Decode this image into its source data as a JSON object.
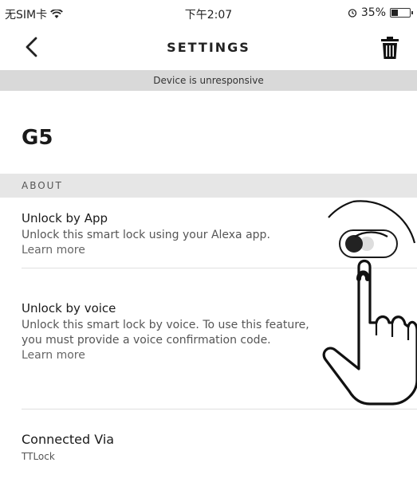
{
  "status_bar": {
    "carrier": "无SIM卡",
    "time": "下午2:07",
    "battery": "35%",
    "battery_level": 0.35
  },
  "nav": {
    "title": "SETTINGS"
  },
  "banner": {
    "text": "Device is unresponsive"
  },
  "device": {
    "name": "G5"
  },
  "section": {
    "header": "ABOUT"
  },
  "unlock_app": {
    "title": "Unlock by App",
    "description": "Unlock this smart lock using your Alexa app.",
    "link": "Learn more",
    "enabled": false
  },
  "unlock_voice": {
    "title": "Unlock by voice",
    "description": "Unlock this smart lock by voice. To use this feature, you must provide a voice confirmation code.",
    "link": "Learn more"
  },
  "connected": {
    "title": "Connected Via",
    "value": "TTLock"
  },
  "icons": {
    "back": "chevron-left-icon",
    "trash": "trash-icon",
    "wifi": "wifi-icon",
    "battery": "battery-icon",
    "hand": "pointing-hand-icon"
  }
}
